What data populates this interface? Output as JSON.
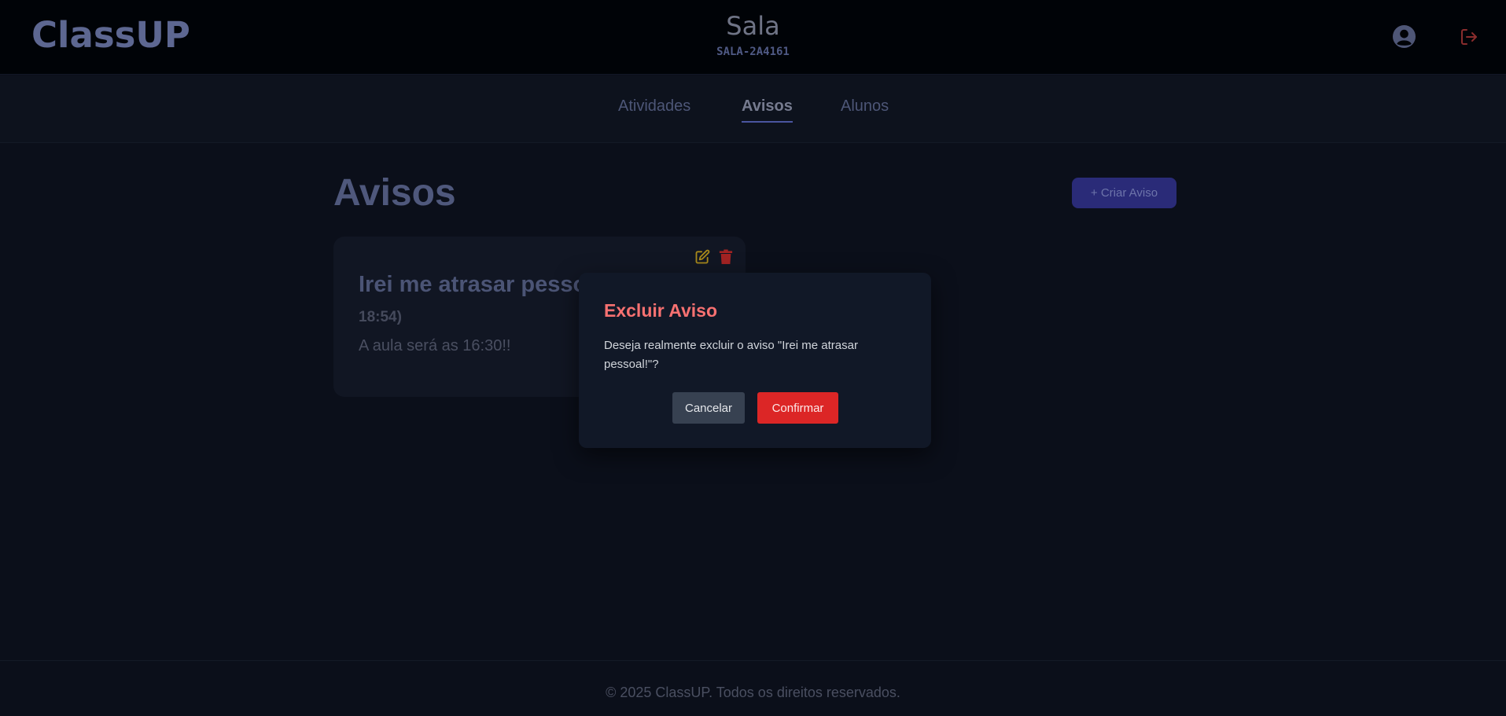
{
  "header": {
    "logo": "ClassUP",
    "room_title": "Sala",
    "room_code": "SALA-2A4161",
    "icons": {
      "user": "user-circle-icon",
      "logout": "logout-icon"
    }
  },
  "tabs": [
    {
      "label": "Atividades",
      "active": false
    },
    {
      "label": "Avisos",
      "active": true
    },
    {
      "label": "Alunos",
      "active": false
    }
  ],
  "main": {
    "title": "Avisos",
    "create_button": "+ Criar Aviso",
    "card": {
      "title": "Irei me atrasar pesso",
      "date": "18:54)",
      "body": "A aula será as 16:30!!",
      "icons": {
        "edit": "edit-icon",
        "delete": "trash-icon"
      }
    }
  },
  "modal": {
    "title": "Excluir Aviso",
    "message": "Deseja realmente excluir o aviso \"Irei me atrasar pessoal!\"?",
    "cancel_label": "Cancelar",
    "confirm_label": "Confirmar"
  },
  "footer": {
    "text": "© 2025 ClassUP. Todos os direitos reservados."
  },
  "colors": {
    "background": "#0b0f1a",
    "accent": "#2a2b78",
    "danger": "#dc2626",
    "modal_title": "#f87171",
    "edit_icon": "#a8891b",
    "delete_icon": "#a32323"
  }
}
